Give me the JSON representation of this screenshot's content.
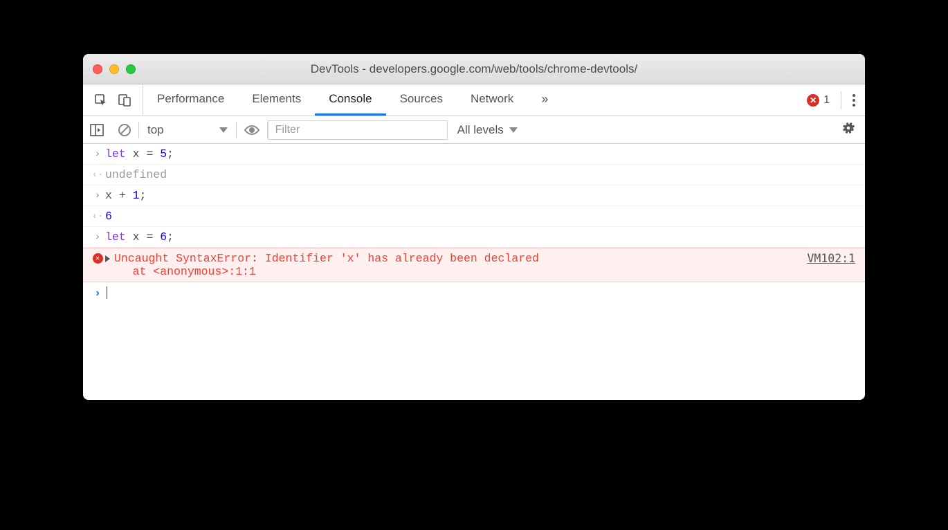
{
  "window": {
    "title": "DevTools - developers.google.com/web/tools/chrome-devtools/"
  },
  "toolbar": {
    "tabs": [
      "Performance",
      "Elements",
      "Console",
      "Sources",
      "Network"
    ],
    "active_tab": "Console",
    "overflow_glyph": "»",
    "error_count": "1"
  },
  "filterbar": {
    "context": "top",
    "filter_placeholder": "Filter",
    "levels_label": "All levels"
  },
  "console": {
    "rows": [
      {
        "type": "input",
        "code": "let x = 5;"
      },
      {
        "type": "return",
        "text": "undefined",
        "class": "undef"
      },
      {
        "type": "input",
        "code": "x + 1;"
      },
      {
        "type": "return",
        "text": "6",
        "class": "num-lit"
      },
      {
        "type": "input",
        "code": "let x = 6;"
      },
      {
        "type": "error",
        "message": "Uncaught SyntaxError: Identifier 'x' has already been declared\n    at <anonymous>:1:1",
        "source": "VM102:1"
      },
      {
        "type": "prompt"
      }
    ]
  }
}
